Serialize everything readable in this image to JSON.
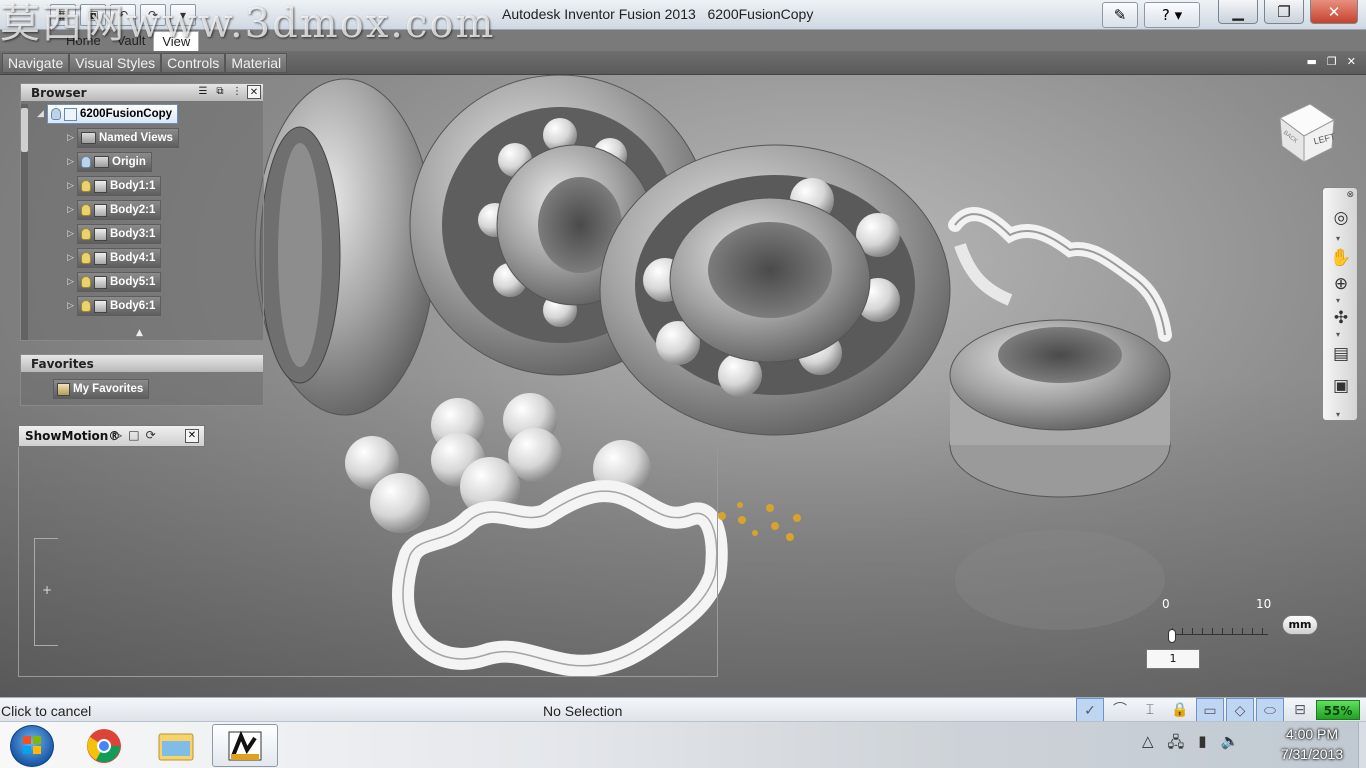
{
  "title_bar": {
    "app_title": "Autodesk Inventor Fusion 2013",
    "document_title": "6200FusionCopy",
    "watermark": "莫西网www.3dmox.com"
  },
  "ribbon_tabs": [
    "Home",
    "Vault",
    "View"
  ],
  "ribbon_active_tab": "View",
  "sub_tabs": [
    "Navigate",
    "Visual Styles",
    "Controls",
    "Material"
  ],
  "browser": {
    "title": "Browser",
    "root": "6200FusionCopy",
    "items": [
      {
        "label": "Named Views",
        "icon": "folder-icon"
      },
      {
        "label": "Origin",
        "icon": "folder-icon"
      },
      {
        "label": "Body1:1",
        "icon": "body-icon"
      },
      {
        "label": "Body2:1",
        "icon": "body-icon"
      },
      {
        "label": "Body3:1",
        "icon": "body-icon"
      },
      {
        "label": "Body4:1",
        "icon": "body-icon"
      },
      {
        "label": "Body5:1",
        "icon": "body-icon"
      },
      {
        "label": "Body6:1",
        "icon": "body-icon"
      }
    ]
  },
  "favorites": {
    "title": "Favorites",
    "item": "My Favorites"
  },
  "showmotion": {
    "title": "ShowMotion®"
  },
  "viewcube": {
    "face_left": "LEFT",
    "face_back": "BACK"
  },
  "scale": {
    "min": "0",
    "max": "10",
    "unit": "mm",
    "value": "1"
  },
  "status": {
    "left": "Click to cancel",
    "center": "No Selection",
    "battery": "55%"
  },
  "clock": {
    "time": "4:00 PM",
    "date": "7/31/2013"
  },
  "colors": {
    "viewport_bg": "#8e8e8e",
    "browser_root_bg": "#d8e6f5",
    "battery": "#1fa21f"
  }
}
